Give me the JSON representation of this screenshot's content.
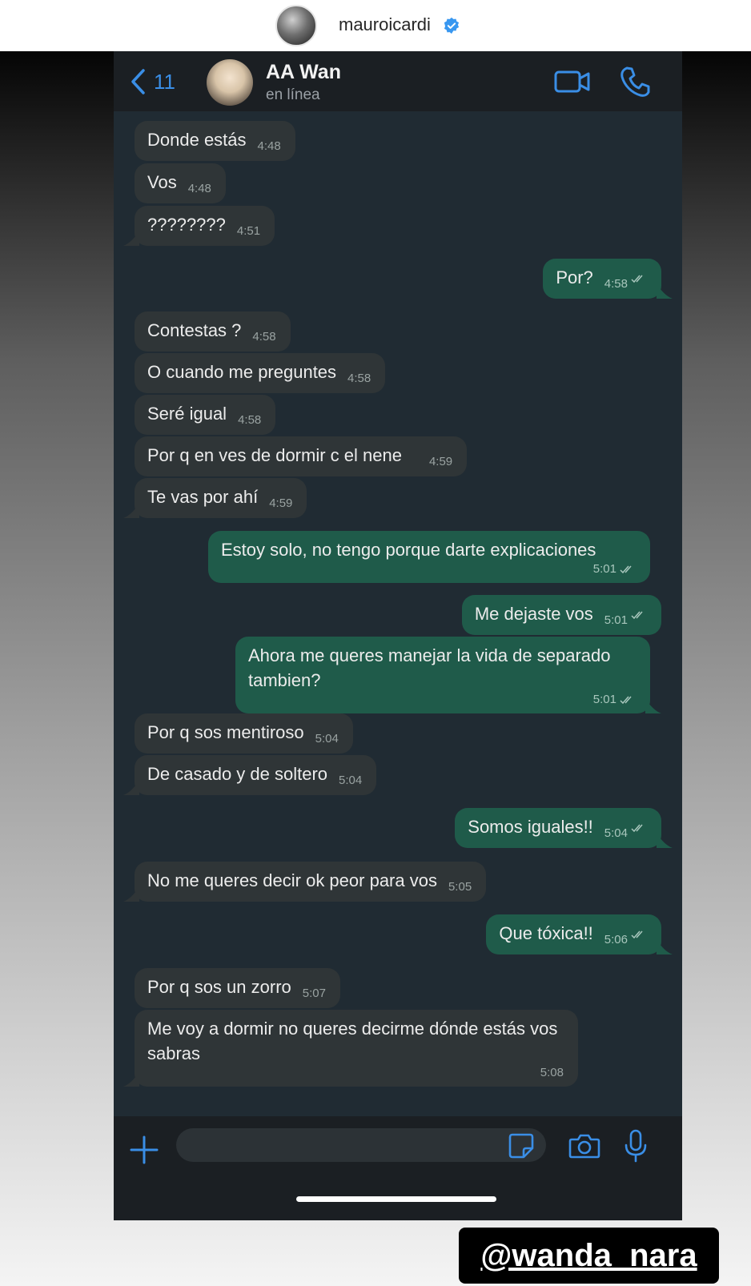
{
  "story": {
    "username": "mauroicardi",
    "tag": "@wanda_nara"
  },
  "chat": {
    "back_count": "11",
    "contact_name": "AA Wan",
    "contact_status": "en línea"
  },
  "messages": [
    {
      "dir": "in",
      "text": "Donde estás",
      "time": "4:48"
    },
    {
      "dir": "in",
      "text": "Vos",
      "time": "4:48"
    },
    {
      "dir": "in",
      "text": "????????",
      "time": "4:51"
    },
    {
      "dir": "out",
      "text": "Por?",
      "time": "4:58"
    },
    {
      "dir": "in",
      "text": "Contestas ?",
      "time": "4:58"
    },
    {
      "dir": "in",
      "text": "O cuando me preguntes",
      "time": "4:58"
    },
    {
      "dir": "in",
      "text": "Seré igual",
      "time": "4:58"
    },
    {
      "dir": "in",
      "text": "Por q en ves de dormir c el nene",
      "time": "4:59"
    },
    {
      "dir": "in",
      "text": "Te vas por ahí",
      "time": "4:59"
    },
    {
      "dir": "out",
      "text": "Estoy solo, no tengo porque darte explicaciones",
      "time": "5:01"
    },
    {
      "dir": "out",
      "text": "Me dejaste vos",
      "time": "5:01"
    },
    {
      "dir": "out",
      "text": "Ahora me queres manejar la vida de separado tambien?",
      "time": "5:01"
    },
    {
      "dir": "in",
      "text": "Por q sos mentiroso",
      "time": "5:04"
    },
    {
      "dir": "in",
      "text": "De casado y de soltero",
      "time": "5:04"
    },
    {
      "dir": "out",
      "text": "Somos iguales!!",
      "time": "5:04"
    },
    {
      "dir": "in",
      "text": "No me queres decir ok peor para vos",
      "time": "5:05"
    },
    {
      "dir": "out",
      "text": "Que tóxica!!",
      "time": "5:06"
    },
    {
      "dir": "in",
      "text": "Por q sos un zorro",
      "time": "5:07"
    },
    {
      "dir": "in",
      "text": "Me voy a dormir no queres decirme dónde estás vos sabras",
      "time": "5:08"
    }
  ],
  "icons": {
    "back": "chevron-left-icon",
    "video": "video-camera-icon",
    "phone": "phone-icon",
    "plus": "plus-icon",
    "sticker": "sticker-icon",
    "camera": "camera-icon",
    "mic": "microphone-icon",
    "verified": "verified-badge-icon"
  },
  "colors": {
    "accent": "#3a8ee6",
    "incoming_bubble": "#2f3537",
    "outgoing_bubble": "#1f5b4a",
    "chat_background": "#202b33",
    "verified": "#3897f0"
  }
}
